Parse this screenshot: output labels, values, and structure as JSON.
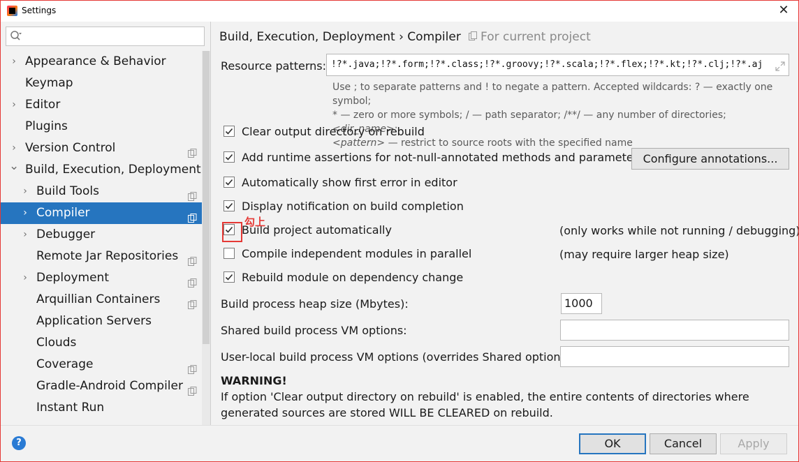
{
  "window": {
    "title": "Settings",
    "close": "✕"
  },
  "search": {
    "placeholder": "",
    "value": ""
  },
  "sidebar": {
    "items": [
      {
        "label": "Appearance & Behavior",
        "indent": 0,
        "expandable": true,
        "expanded": false,
        "project_icon": false,
        "selected": false
      },
      {
        "label": "Keymap",
        "indent": 0,
        "expandable": false,
        "expanded": false,
        "project_icon": false,
        "selected": false
      },
      {
        "label": "Editor",
        "indent": 0,
        "expandable": true,
        "expanded": false,
        "project_icon": false,
        "selected": false
      },
      {
        "label": "Plugins",
        "indent": 0,
        "expandable": false,
        "expanded": false,
        "project_icon": false,
        "selected": false
      },
      {
        "label": "Version Control",
        "indent": 0,
        "expandable": true,
        "expanded": false,
        "project_icon": true,
        "selected": false
      },
      {
        "label": "Build, Execution, Deployment",
        "indent": 0,
        "expandable": true,
        "expanded": true,
        "project_icon": false,
        "selected": false
      },
      {
        "label": "Build Tools",
        "indent": 1,
        "expandable": true,
        "expanded": false,
        "project_icon": true,
        "selected": false
      },
      {
        "label": "Compiler",
        "indent": 1,
        "expandable": true,
        "expanded": false,
        "project_icon": true,
        "selected": true
      },
      {
        "label": "Debugger",
        "indent": 1,
        "expandable": true,
        "expanded": false,
        "project_icon": false,
        "selected": false
      },
      {
        "label": "Remote Jar Repositories",
        "indent": 1,
        "expandable": false,
        "expanded": false,
        "project_icon": true,
        "selected": false
      },
      {
        "label": "Deployment",
        "indent": 1,
        "expandable": true,
        "expanded": false,
        "project_icon": true,
        "selected": false
      },
      {
        "label": "Arquillian Containers",
        "indent": 1,
        "expandable": false,
        "expanded": false,
        "project_icon": true,
        "selected": false
      },
      {
        "label": "Application Servers",
        "indent": 1,
        "expandable": false,
        "expanded": false,
        "project_icon": false,
        "selected": false
      },
      {
        "label": "Clouds",
        "indent": 1,
        "expandable": false,
        "expanded": false,
        "project_icon": false,
        "selected": false
      },
      {
        "label": "Coverage",
        "indent": 1,
        "expandable": false,
        "expanded": false,
        "project_icon": true,
        "selected": false
      },
      {
        "label": "Gradle-Android Compiler",
        "indent": 1,
        "expandable": false,
        "expanded": false,
        "project_icon": true,
        "selected": false
      },
      {
        "label": "Instant Run",
        "indent": 1,
        "expandable": false,
        "expanded": false,
        "project_icon": false,
        "selected": false
      }
    ]
  },
  "header": {
    "breadcrumb": "Build, Execution, Deployment › Compiler",
    "project_scope": "For current project"
  },
  "resource_patterns": {
    "label": "Resource patterns:",
    "value": "!?*.java;!?*.form;!?*.class;!?*.groovy;!?*.scala;!?*.flex;!?*.kt;!?*.clj;!?*.aj",
    "help_line1": "Use ; to separate patterns and ! to negate a pattern. Accepted wildcards: ? — exactly one symbol;",
    "help_line2_a": "* — zero or more symbols; / — path separator; /**/ — any number of directories; ",
    "help_line2_b": "<dir_name>",
    "help_line2_c": ":",
    "help_line3_a": "<pattern>",
    "help_line3_b": " — restrict to source roots with the specified name"
  },
  "options": [
    {
      "label": "Clear output directory on rebuild",
      "checked": true
    },
    {
      "label": "Add runtime assertions for not-null-annotated methods and parameters",
      "checked": true
    },
    {
      "label": "Automatically show first error in editor",
      "checked": true
    },
    {
      "label": "Display notification on build completion",
      "checked": true
    },
    {
      "label": "Build project automatically",
      "checked": true
    },
    {
      "label": "Compile independent modules in parallel",
      "checked": false
    },
    {
      "label": "Rebuild module on dependency change",
      "checked": true
    }
  ],
  "configure_annotations_label": "Configure annotations...",
  "notes": {
    "build_auto": "(only works while not running / debugging)",
    "parallel": "(may require larger heap size)"
  },
  "annotation_mark": "勾上",
  "heap": {
    "label": "Build process heap size (Mbytes):",
    "value": "1000"
  },
  "shared_vm": {
    "label": "Shared build process VM options:",
    "value": ""
  },
  "user_vm": {
    "label": "User-local build process VM options (overrides Shared options):",
    "value": ""
  },
  "warning": {
    "title": "WARNING!",
    "body": "If option 'Clear output directory on rebuild' is enabled, the entire contents of directories where generated sources are stored WILL BE CLEARED on rebuild."
  },
  "footer": {
    "help": "?",
    "ok": "OK",
    "cancel": "Cancel",
    "apply": "Apply"
  },
  "colors": {
    "selection": "#2675bf",
    "annotation": "#e53935",
    "ok_border": "#2675bf"
  }
}
